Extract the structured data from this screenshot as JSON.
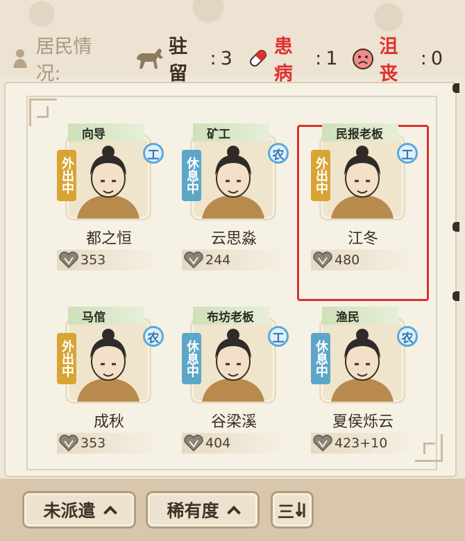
{
  "header": {
    "title": "居民情况:",
    "stats": [
      {
        "label": "驻留",
        "value": "3",
        "icon": "horse-icon",
        "label_color": "#3a2e22"
      },
      {
        "label": "患病",
        "value": "1",
        "icon": "pill-icon",
        "label_color": "#e0302e"
      },
      {
        "label": "沮丧",
        "value": "0",
        "icon": "sad-face-icon",
        "label_color": "#e0302e"
      }
    ]
  },
  "residents": [
    {
      "role": "向导",
      "status": "外出中",
      "status_type": "out",
      "job": "工",
      "name": "都之恒",
      "score": "353"
    },
    {
      "role": "矿工",
      "status": "休息中",
      "status_type": "rest",
      "job": "农",
      "name": "云思淼",
      "score": "244"
    },
    {
      "role": "民报老板",
      "status": "外出中",
      "status_type": "out",
      "job": "工",
      "name": "江冬",
      "score": "480",
      "selected": true
    },
    {
      "role": "马倌",
      "status": "外出中",
      "status_type": "out",
      "job": "农",
      "name": "成秋",
      "score": "353"
    },
    {
      "role": "布坊老板",
      "status": "休息中",
      "status_type": "rest",
      "job": "工",
      "name": "谷梁溪",
      "score": "404"
    },
    {
      "role": "渔民",
      "status": "休息中",
      "status_type": "rest",
      "job": "农",
      "name": "夏侯烁云",
      "score": "423+10"
    }
  ],
  "toolbar": {
    "filter_label": "未派遣",
    "sort_label": "稀有度",
    "order_icon": "sort-order-icon",
    "order_label": "三"
  },
  "colors": {
    "selection": "#d9302c",
    "status_out": "#d8a434",
    "status_rest": "#5ca6c8",
    "job_badge": "#5ba8d8"
  }
}
